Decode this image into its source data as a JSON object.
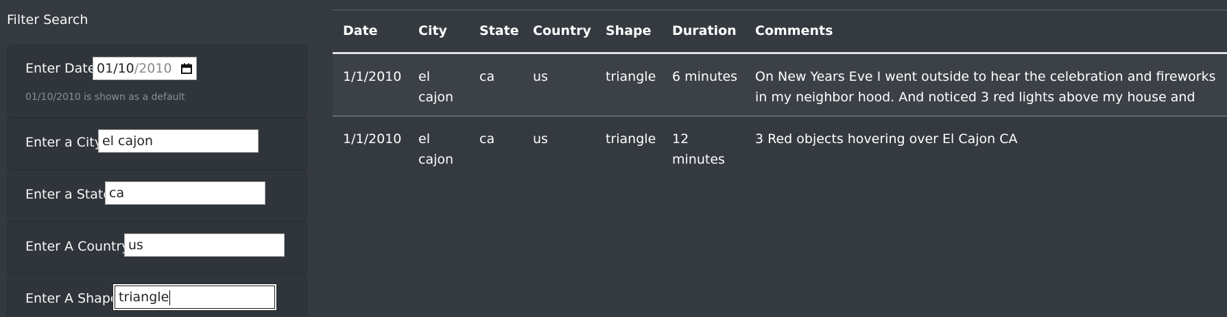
{
  "filter": {
    "title": "Filter Search",
    "date": {
      "label": "Enter Date",
      "month": "01",
      "day": "10",
      "year": "2010",
      "hint": "01/10/2010 is shown as a default"
    },
    "city": {
      "label": "Enter a City",
      "value": "el cajon"
    },
    "state": {
      "label": "Enter a State",
      "value": "ca"
    },
    "country": {
      "label": "Enter A Country",
      "value": "us"
    },
    "shape": {
      "label": "Enter A Shape",
      "value": "triangle"
    }
  },
  "table": {
    "columns": [
      "Date",
      "City",
      "State",
      "Country",
      "Shape",
      "Duration",
      "Comments"
    ],
    "rows": [
      {
        "date": "1/1/2010",
        "city": "el cajon",
        "state": "ca",
        "country": "us",
        "shape": "triangle",
        "duration": "6 minutes",
        "comments": "On New Years Eve I went outside to hear the celebration and fireworks in my neighbor hood. And noticed 3 red lights above my house and"
      },
      {
        "date": "1/1/2010",
        "city": "el cajon",
        "state": "ca",
        "country": "us",
        "shape": "triangle",
        "duration": "12 minutes",
        "comments": "3 Red objects hovering over El Cajon CA"
      }
    ]
  }
}
